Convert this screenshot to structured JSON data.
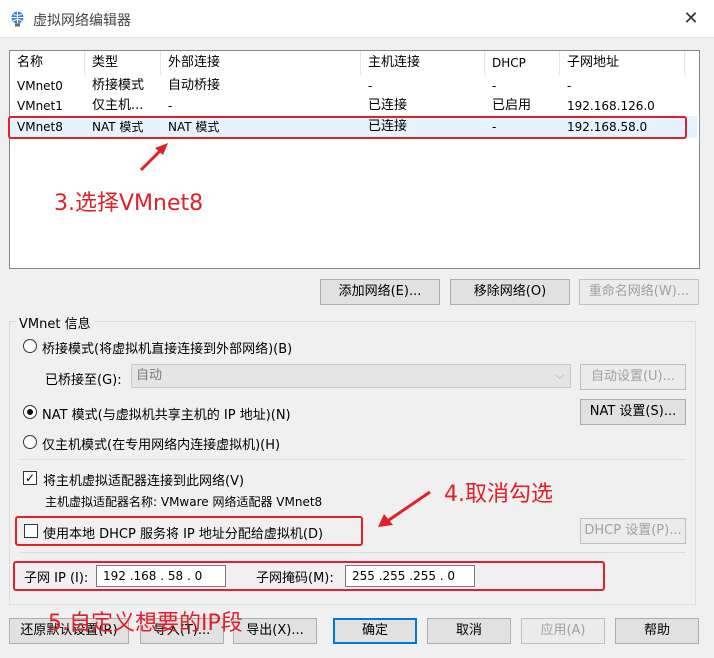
{
  "window": {
    "title": "虚拟网络编辑器",
    "close_glyph": "✕"
  },
  "table": {
    "headers": [
      "名称",
      "类型",
      "外部连接",
      "主机连接",
      "DHCP",
      "子网地址"
    ],
    "rows": [
      [
        "VMnet0",
        "桥接模式",
        "自动桥接",
        "-",
        "-",
        "-"
      ],
      [
        "VMnet1",
        "仅主机...",
        "-",
        "已连接",
        "已启用",
        "192.168.126.0"
      ],
      [
        "VMnet8",
        "NAT 模式",
        "NAT 模式",
        "已连接",
        "-",
        "192.168.58.0"
      ]
    ],
    "selected_row": 2
  },
  "list_buttons": {
    "add": "添加网络(E)...",
    "remove": "移除网络(O)",
    "rename": "重命名网络(W)..."
  },
  "info": {
    "group_label": "VMnet 信息",
    "bridge_label": "桥接模式(将虚拟机直接连接到外部网络)(B)",
    "bridged_to_label": "已桥接至(G):",
    "bridged_to_value": "自动",
    "auto_settings": "自动设置(U)...",
    "nat_label": "NAT 模式(与虚拟机共享主机的 IP 地址)(N)",
    "nat_settings": "NAT 设置(S)...",
    "hostonly_label": "仅主机模式(在专用网络内连接虚拟机)(H)",
    "connect_adapter_label": "将主机虚拟适配器连接到此网络(V)",
    "connect_adapter_checked": true,
    "adapter_name_label": "主机虚拟适配器名称: VMware 网络适配器 VMnet8",
    "dhcp_label": "使用本地 DHCP 服务将 IP 地址分配给虚拟机(D)",
    "dhcp_checked": false,
    "dhcp_settings": "DHCP 设置(P)...",
    "subnet_ip_label": "子网 IP (I):",
    "subnet_ip_value": "192 .168 . 58 . 0",
    "subnet_mask_label": "子网掩码(M):",
    "subnet_mask_value": "255 .255 .255 . 0",
    "selected_mode": "nat"
  },
  "bottom_buttons": {
    "restore": "还原默认设置(R)",
    "import": "导入(T)...",
    "export": "导出(X)...",
    "ok": "确定",
    "cancel": "取消",
    "apply": "应用(A)",
    "help": "帮助"
  },
  "annotations": {
    "step3": "3.选择VMnet8",
    "step4": "4.取消勾选",
    "step5": "5.自定义想要的IP段",
    "color": "#e0202a"
  },
  "check_glyph": "✓"
}
